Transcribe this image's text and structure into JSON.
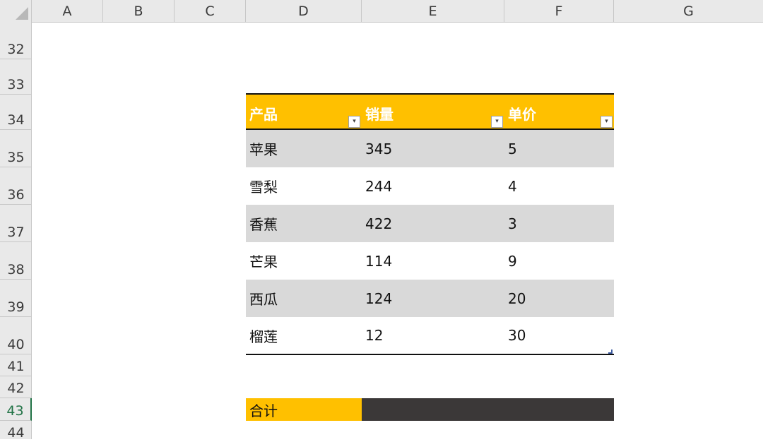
{
  "columns": [
    "A",
    "B",
    "C",
    "D",
    "E",
    "F",
    "G"
  ],
  "rows": [
    "32",
    "33",
    "34",
    "35",
    "36",
    "37",
    "38",
    "39",
    "40",
    "41",
    "42",
    "43",
    "44"
  ],
  "active_row": "43",
  "table": {
    "headers": [
      "产品",
      "销量",
      "单价"
    ],
    "filter_symbol": "▾",
    "rows": [
      [
        "苹果",
        "345",
        "5"
      ],
      [
        "雪梨",
        "244",
        "4"
      ],
      [
        "香蕉",
        "422",
        "3"
      ],
      [
        "芒果",
        "114",
        "9"
      ],
      [
        "西瓜",
        "124",
        "20"
      ],
      [
        "榴莲",
        "12",
        "30"
      ]
    ]
  },
  "total": {
    "label": "合计",
    "value": ""
  },
  "colors": {
    "header_fill": "#FFC000",
    "band_fill": "#D9D9D9",
    "total_value_fill": "#3B3838",
    "active_row_color": "#217346"
  }
}
